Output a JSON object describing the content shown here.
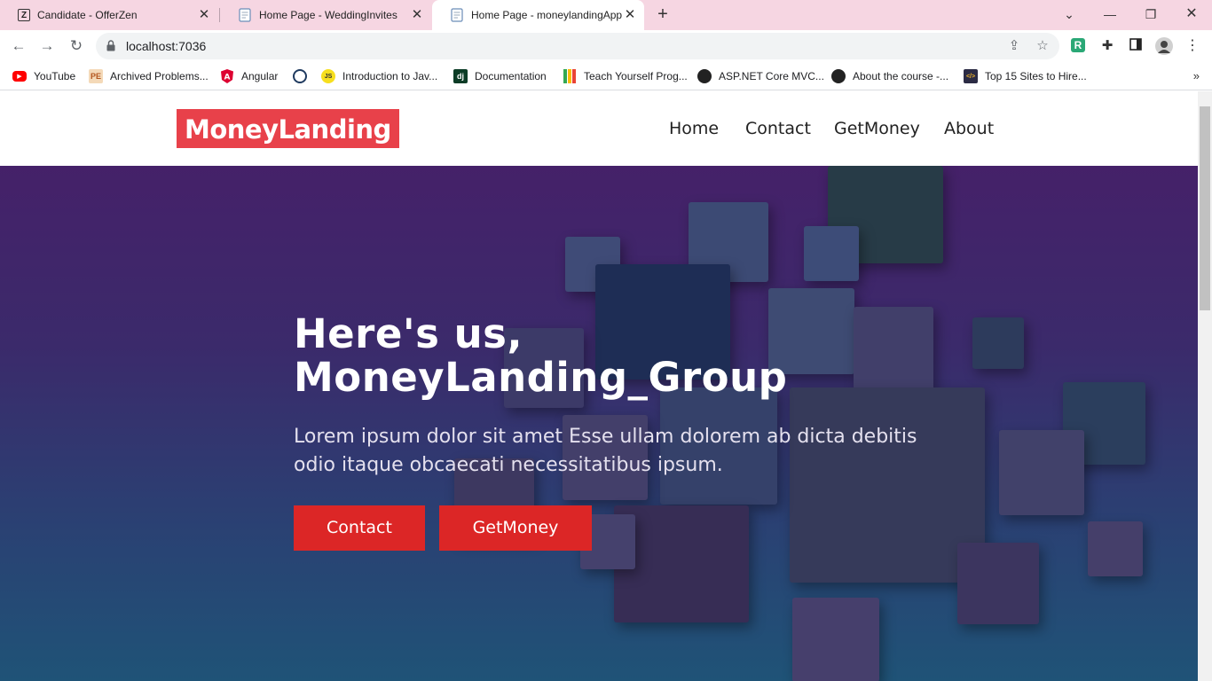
{
  "browser": {
    "tabs": [
      {
        "title": "Candidate - OfferZen",
        "icon": "Z"
      },
      {
        "title": "Home Page - WeddingInvites",
        "icon": "page-icon"
      },
      {
        "title": "Home Page - moneylandingApp",
        "icon": "page-icon",
        "active": true
      }
    ],
    "url": "localhost:7036",
    "bookmarks": [
      {
        "label": "YouTube",
        "icon": "youtube-icon"
      },
      {
        "label": "Archived Problems...",
        "icon": "PE"
      },
      {
        "label": "Angular",
        "icon": "angular-icon"
      },
      {
        "label": "",
        "icon": "globe-icon"
      },
      {
        "label": "Introduction to Jav...",
        "icon": "JS"
      },
      {
        "label": "Documentation",
        "icon": "dj"
      },
      {
        "label": "Teach Yourself Prog...",
        "icon": "bookmark-icon"
      },
      {
        "label": "ASP.NET Core MVC...",
        "icon": "globe-icon"
      },
      {
        "label": "About the course -...",
        "icon": "globe-icon"
      },
      {
        "label": "Top 15 Sites to Hire...",
        "icon": "site-icon"
      }
    ]
  },
  "site": {
    "logo": "MoneyLanding",
    "nav": [
      "Home",
      "Contact",
      "GetMoney",
      "About"
    ],
    "hero": {
      "title_line1": "Here's us,",
      "title_line2": "MoneyLanding_Group",
      "text": "Lorem ipsum dolor sit amet Esse ullam dolorem ab dicta debitis odio itaque obcaecati necessitatibus ipsum.",
      "buttons": [
        "Contact",
        "GetMoney"
      ]
    }
  },
  "colors": {
    "logo_bg": "#e8414a",
    "button_bg": "#dc2626",
    "hero_top": "#452169",
    "hero_bottom": "#1f5377",
    "tabbar_bg": "#f6d6e2"
  }
}
